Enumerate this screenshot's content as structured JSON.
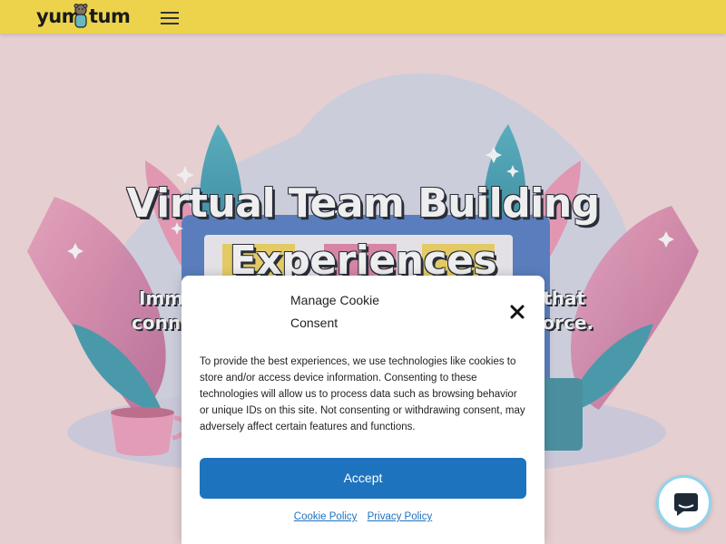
{
  "header": {
    "logo": {
      "part1": "yum",
      "part2": "tum"
    },
    "menu_icon": "hamburger-menu-icon",
    "background_color": "#fee14f"
  },
  "hero": {
    "title_line1": "Virtual Team Building",
    "title_line2": "Experiences",
    "subtitle_line1_left": "Imm",
    "subtitle_line1_right": "that",
    "subtitle_line2_left": "conn",
    "subtitle_line2_right": "orce."
  },
  "cookie_modal": {
    "title": "Manage Cookie Consent",
    "body": "To provide the best experiences, we use technologies like cookies to store and/or access device information. Consenting to these technologies will allow us to process data such as browsing behavior or unique IDs on this site. Not consenting or withdrawing consent, may adversely affect certain features and functions.",
    "accept_label": "Accept",
    "cookie_policy_label": "Cookie Policy",
    "privacy_policy_label": "Privacy Policy",
    "close_icon": "close-icon",
    "accent_color": "#1e73be"
  },
  "chat_widget": {
    "icon": "chat-bubble-icon"
  }
}
